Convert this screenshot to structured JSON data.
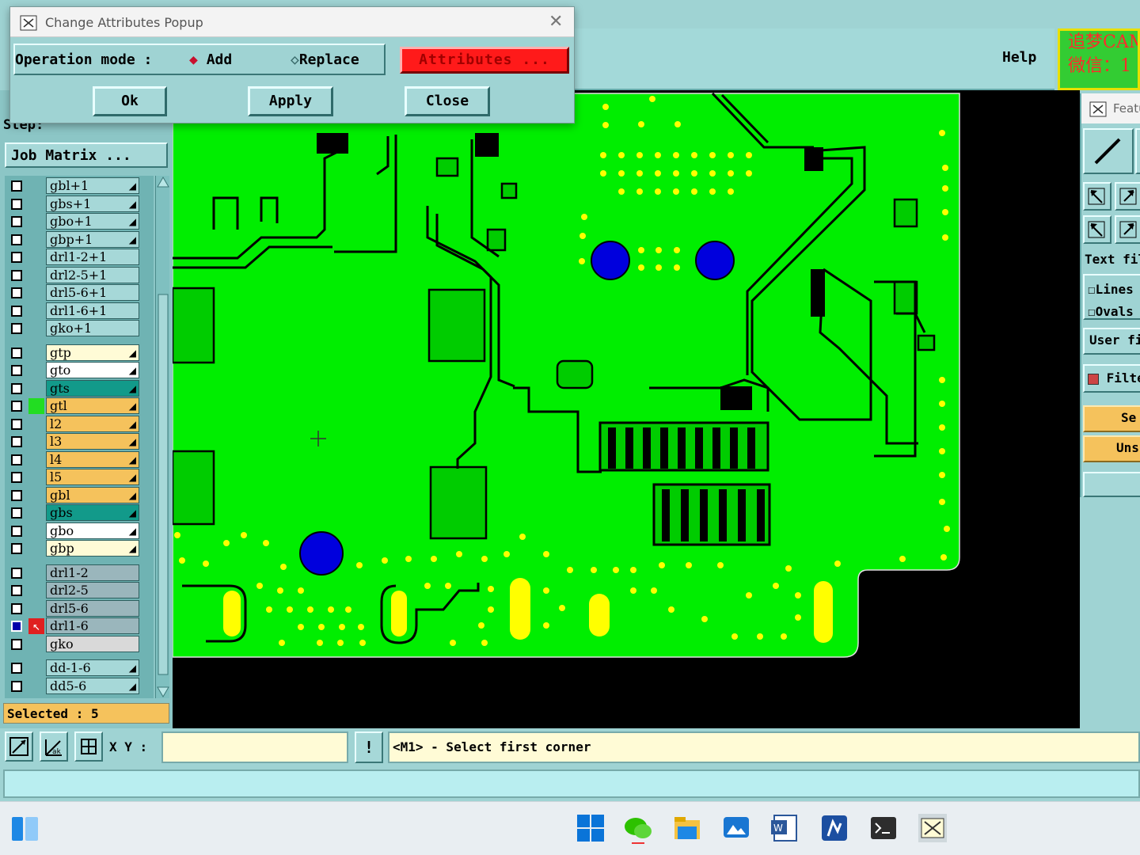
{
  "popup": {
    "title": "Change Attributes Popup",
    "operation_mode_label": "Operation mode :",
    "mode_add": "Add",
    "mode_replace": "Replace",
    "selected_mode": "Add",
    "attributes_button": "Attributes ...",
    "ok": "Ok",
    "apply": "Apply",
    "close": "Close"
  },
  "header": {
    "help": "Help",
    "brand_line1": "追梦CAM",
    "brand_line2": "微信：1"
  },
  "left_panel": {
    "step_label": "Step:",
    "job_matrix": "Job Matrix ...",
    "layers": [
      {
        "name": "gbl+1",
        "color": "#a6d8d8",
        "arrow": true
      },
      {
        "name": "gbs+1",
        "color": "#a6d8d8",
        "arrow": true
      },
      {
        "name": "gbo+1",
        "color": "#a6d8d8",
        "arrow": true
      },
      {
        "name": "gbp+1",
        "color": "#a6d8d8",
        "arrow": true
      },
      {
        "name": "drl1-2+1",
        "color": "#a6d8d8",
        "arrow": false
      },
      {
        "name": "drl2-5+1",
        "color": "#a6d8d8",
        "arrow": false
      },
      {
        "name": "drl5-6+1",
        "color": "#a6d8d8",
        "arrow": false
      },
      {
        "name": "drl1-6+1",
        "color": "#a6d8d8",
        "arrow": false
      },
      {
        "name": "gko+1",
        "color": "#a6d8d8",
        "arrow": false
      },
      {
        "name": "gtp",
        "color": "#fffbd6",
        "arrow": true
      },
      {
        "name": "gto",
        "color": "#ffffff",
        "arrow": true
      },
      {
        "name": "gts",
        "color": "#129a8a",
        "arrow": true
      },
      {
        "name": "gtl",
        "color": "#f5c25c",
        "arrow": true,
        "active": true
      },
      {
        "name": "l2",
        "color": "#f5c25c",
        "arrow": true
      },
      {
        "name": "l3",
        "color": "#f5c25c",
        "arrow": true
      },
      {
        "name": "l4",
        "color": "#f5c25c",
        "arrow": true
      },
      {
        "name": "l5",
        "color": "#f5c25c",
        "arrow": true
      },
      {
        "name": "gbl",
        "color": "#f5c25c",
        "arrow": true
      },
      {
        "name": "gbs",
        "color": "#129a8a",
        "arrow": true
      },
      {
        "name": "gbo",
        "color": "#ffffff",
        "arrow": true
      },
      {
        "name": "gbp",
        "color": "#fffbd6",
        "arrow": true
      },
      {
        "name": "drl1-2",
        "color": "#9ab6bc",
        "arrow": false
      },
      {
        "name": "drl2-5",
        "color": "#9ab6bc",
        "arrow": false
      },
      {
        "name": "drl5-6",
        "color": "#9ab6bc",
        "arrow": false
      },
      {
        "name": "drl1-6",
        "color": "#9ab6bc",
        "arrow": false,
        "work": true
      },
      {
        "name": "gko",
        "color": "#d9d9d9",
        "arrow": false
      },
      {
        "name": "dd-1-6",
        "color": "#a6d8d8",
        "arrow": true
      },
      {
        "name": "dd5-6",
        "color": "#a6d8d8",
        "arrow": true
      }
    ],
    "selected": "Selected : 5"
  },
  "status": {
    "xy_label": "X Y :",
    "xy_value": "",
    "prompt": "<M1> - Select first corner"
  },
  "right_panel": {
    "title": "Featu",
    "text_filter": "Text fil",
    "lines": "Lines",
    "ovals": "Ovals",
    "user_filter": "User fi",
    "filter": "Filte",
    "select": "Se",
    "unselect": "Uns"
  },
  "colors": {
    "board": "#00ee00",
    "trace": "#000000",
    "pad": "#00cc00",
    "via": "#ffff00",
    "hole": "#0000dd",
    "attributes_button": "#ff1a1a"
  }
}
